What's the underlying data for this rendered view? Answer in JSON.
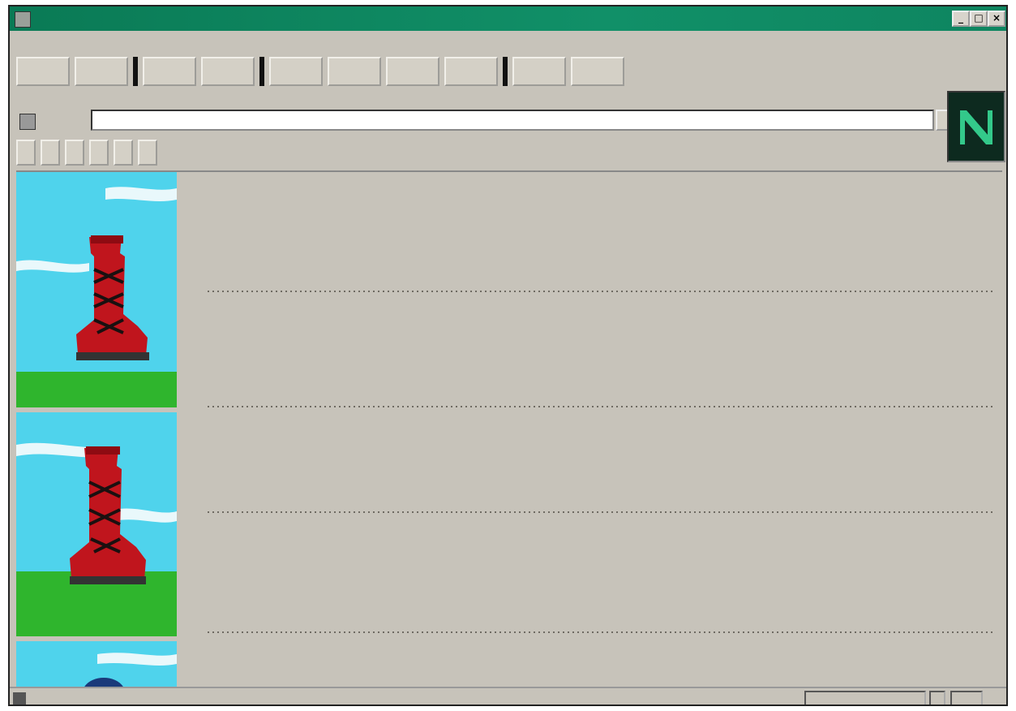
{
  "window": {
    "title": ""
  },
  "menus": [
    "",
    "",
    "",
    "",
    "",
    "",
    "",
    "",
    ""
  ],
  "toolbar": [
    "",
    "",
    "",
    "",
    "",
    "",
    "",
    "",
    "",
    ""
  ],
  "location": {
    "label": "",
    "url": ""
  },
  "directory_buttons": [
    "",
    "",
    "",
    "",
    "",
    ""
  ],
  "sidebar": {
    "logo": "",
    "side_words": [
      "",
      "",
      "",
      ""
    ],
    "link": ""
  },
  "report": {
    "heading": [
      "",
      "",
      ""
    ],
    "sec1": {
      "header": "",
      "header_right": "",
      "rows": [
        [
          "",
          "",
          "",
          ""
        ],
        [
          "",
          "",
          "",
          ""
        ],
        [
          "",
          "",
          "",
          ""
        ],
        [
          "",
          "",
          "",
          ""
        ]
      ]
    },
    "sec2": {
      "header": "",
      "rows": [
        [
          "",
          "",
          "",
          ""
        ],
        [
          "",
          "",
          "",
          ""
        ],
        [
          "",
          "",
          "",
          ""
        ]
      ]
    },
    "sec3": {
      "header": "",
      "header_right": "",
      "rows": [
        [
          "",
          "",
          "",
          ""
        ],
        [
          "",
          "",
          "",
          ""
        ],
        [
          "",
          "",
          "",
          ""
        ],
        [
          "",
          "",
          "",
          ""
        ]
      ]
    },
    "footnote": ""
  },
  "status": {
    "text": ""
  },
  "colors": {
    "titlebar": "#0e8560",
    "sky": "#4fd3ec",
    "grass": "#2fb52d",
    "boot": "#c0151d",
    "background": "#c7c3ba"
  }
}
